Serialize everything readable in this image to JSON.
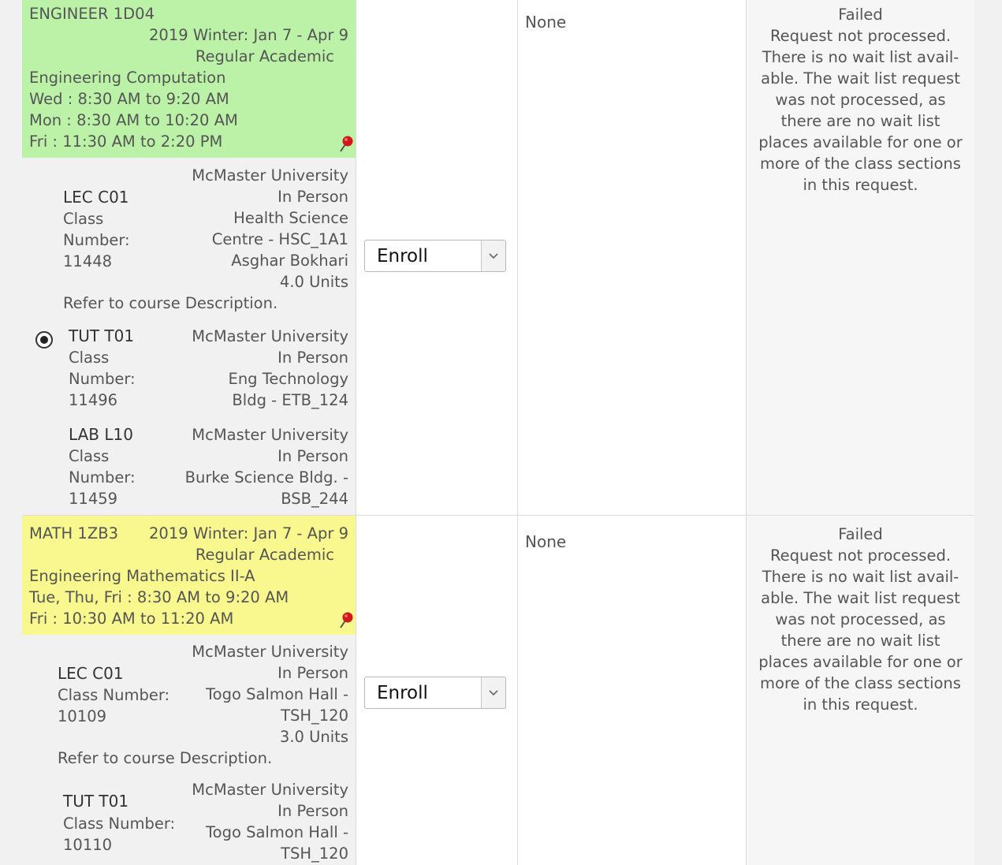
{
  "courses": [
    {
      "header": {
        "code": "ENGINEER 1D04",
        "term": "2019 Winter: Jan 7 - Apr 9",
        "career": "Regular Academic",
        "title": "Engineering Computation",
        "times": [
          "Wed : 8:30 AM to 9:20 AM",
          "Mon : 8:30 AM to 10:20 AM",
          "Fri : 11:30 AM to 2:20 PM"
        ],
        "color": "#bcf2a8"
      },
      "sections": [
        {
          "name": "LEC C01",
          "class_number_label": "Class Number:",
          "class_number_line1": "Class",
          "class_number_line2": "Number:",
          "class_number": "11448",
          "right_lines": [
            "McMaster University",
            "In Person",
            "Health Science",
            "Centre - HSC_1A1",
            "Asghar Bokhari",
            "4.0 Units"
          ],
          "note": "Refer to course Description."
        },
        {
          "name": "TUT T01",
          "class_number_line1": "Class",
          "class_number_line2": "Number:",
          "class_number": "11496",
          "right_lines": [
            "McMaster University",
            "In Person",
            "Eng Technology",
            "Bldg - ETB_124"
          ],
          "selected": true
        },
        {
          "name": "LAB L10",
          "class_number_line1": "Class",
          "class_number_line2": "Number:",
          "class_number": "11459",
          "right_lines": [
            "McMaster University",
            "In Person",
            "Burke Science Bldg. -",
            "BSB_244"
          ]
        }
      ],
      "action": "Enroll",
      "waitlist": "None",
      "status_lines": [
        "Failed",
        "Request not processed.",
        "There is no wait list avail-",
        "able. The wait list request",
        "was not processed, as",
        "there are no wait list",
        "places available for one or",
        "more of the class sections",
        "in this request."
      ]
    },
    {
      "header": {
        "code": "MATH 1ZB3",
        "term": "2019 Winter: Jan 7 - Apr 9",
        "career": "Regular Academic",
        "title": "Engineering Mathematics II-A",
        "times": [
          "Tue, Thu, Fri : 8:30 AM to 9:20 AM",
          "Fri : 10:30 AM to 11:20 AM"
        ],
        "color": "#f8f88e"
      },
      "sections": [
        {
          "name": "LEC C01",
          "class_number_label": "Class Number:",
          "class_number": "10109",
          "right_lines": [
            "McMaster University",
            "In Person",
            "Togo Salmon Hall -",
            "TSH_120",
            "3.0 Units"
          ],
          "note": "Refer to course Description."
        },
        {
          "name": "TUT T01",
          "class_number_label": "Class Number:",
          "class_number": "10110",
          "right_lines": [
            "McMaster University",
            "In Person",
            "Togo Salmon Hall -",
            "TSH_120"
          ]
        }
      ],
      "action": "Enroll",
      "waitlist": "None",
      "status_lines": [
        "Failed",
        "Request not processed.",
        "There is no wait list avail-",
        "able. The wait list request",
        "was not processed, as",
        "there are no wait list",
        "places available for one or",
        "more of the class sections",
        "in this request."
      ]
    }
  ]
}
